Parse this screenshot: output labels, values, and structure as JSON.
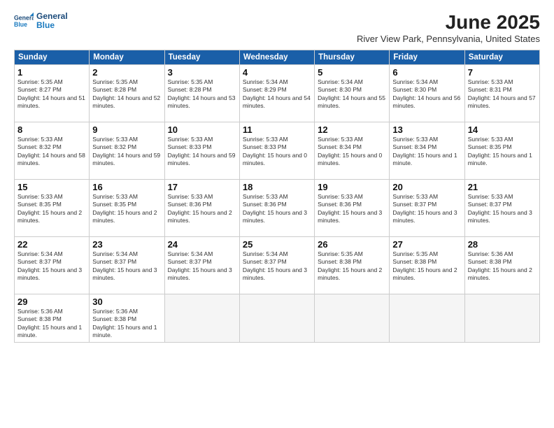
{
  "header": {
    "logo_line1": "General",
    "logo_line2": "Blue",
    "title": "June 2025",
    "location": "River View Park, Pennsylvania, United States"
  },
  "days_of_week": [
    "Sunday",
    "Monday",
    "Tuesday",
    "Wednesday",
    "Thursday",
    "Friday",
    "Saturday"
  ],
  "weeks": [
    [
      {
        "num": "1",
        "sunrise": "5:35 AM",
        "sunset": "8:27 PM",
        "daylight": "14 hours and 51 minutes."
      },
      {
        "num": "2",
        "sunrise": "5:35 AM",
        "sunset": "8:28 PM",
        "daylight": "14 hours and 52 minutes."
      },
      {
        "num": "3",
        "sunrise": "5:35 AM",
        "sunset": "8:28 PM",
        "daylight": "14 hours and 53 minutes."
      },
      {
        "num": "4",
        "sunrise": "5:34 AM",
        "sunset": "8:29 PM",
        "daylight": "14 hours and 54 minutes."
      },
      {
        "num": "5",
        "sunrise": "5:34 AM",
        "sunset": "8:30 PM",
        "daylight": "14 hours and 55 minutes."
      },
      {
        "num": "6",
        "sunrise": "5:34 AM",
        "sunset": "8:30 PM",
        "daylight": "14 hours and 56 minutes."
      },
      {
        "num": "7",
        "sunrise": "5:33 AM",
        "sunset": "8:31 PM",
        "daylight": "14 hours and 57 minutes."
      }
    ],
    [
      {
        "num": "8",
        "sunrise": "5:33 AM",
        "sunset": "8:32 PM",
        "daylight": "14 hours and 58 minutes."
      },
      {
        "num": "9",
        "sunrise": "5:33 AM",
        "sunset": "8:32 PM",
        "daylight": "14 hours and 59 minutes."
      },
      {
        "num": "10",
        "sunrise": "5:33 AM",
        "sunset": "8:33 PM",
        "daylight": "14 hours and 59 minutes."
      },
      {
        "num": "11",
        "sunrise": "5:33 AM",
        "sunset": "8:33 PM",
        "daylight": "15 hours and 0 minutes."
      },
      {
        "num": "12",
        "sunrise": "5:33 AM",
        "sunset": "8:34 PM",
        "daylight": "15 hours and 0 minutes."
      },
      {
        "num": "13",
        "sunrise": "5:33 AM",
        "sunset": "8:34 PM",
        "daylight": "15 hours and 1 minute."
      },
      {
        "num": "14",
        "sunrise": "5:33 AM",
        "sunset": "8:35 PM",
        "daylight": "15 hours and 1 minute."
      }
    ],
    [
      {
        "num": "15",
        "sunrise": "5:33 AM",
        "sunset": "8:35 PM",
        "daylight": "15 hours and 2 minutes."
      },
      {
        "num": "16",
        "sunrise": "5:33 AM",
        "sunset": "8:35 PM",
        "daylight": "15 hours and 2 minutes."
      },
      {
        "num": "17",
        "sunrise": "5:33 AM",
        "sunset": "8:36 PM",
        "daylight": "15 hours and 2 minutes."
      },
      {
        "num": "18",
        "sunrise": "5:33 AM",
        "sunset": "8:36 PM",
        "daylight": "15 hours and 3 minutes."
      },
      {
        "num": "19",
        "sunrise": "5:33 AM",
        "sunset": "8:36 PM",
        "daylight": "15 hours and 3 minutes."
      },
      {
        "num": "20",
        "sunrise": "5:33 AM",
        "sunset": "8:37 PM",
        "daylight": "15 hours and 3 minutes."
      },
      {
        "num": "21",
        "sunrise": "5:33 AM",
        "sunset": "8:37 PM",
        "daylight": "15 hours and 3 minutes."
      }
    ],
    [
      {
        "num": "22",
        "sunrise": "5:34 AM",
        "sunset": "8:37 PM",
        "daylight": "15 hours and 3 minutes."
      },
      {
        "num": "23",
        "sunrise": "5:34 AM",
        "sunset": "8:37 PM",
        "daylight": "15 hours and 3 minutes."
      },
      {
        "num": "24",
        "sunrise": "5:34 AM",
        "sunset": "8:37 PM",
        "daylight": "15 hours and 3 minutes."
      },
      {
        "num": "25",
        "sunrise": "5:34 AM",
        "sunset": "8:37 PM",
        "daylight": "15 hours and 3 minutes."
      },
      {
        "num": "26",
        "sunrise": "5:35 AM",
        "sunset": "8:38 PM",
        "daylight": "15 hours and 2 minutes."
      },
      {
        "num": "27",
        "sunrise": "5:35 AM",
        "sunset": "8:38 PM",
        "daylight": "15 hours and 2 minutes."
      },
      {
        "num": "28",
        "sunrise": "5:36 AM",
        "sunset": "8:38 PM",
        "daylight": "15 hours and 2 minutes."
      }
    ],
    [
      {
        "num": "29",
        "sunrise": "5:36 AM",
        "sunset": "8:38 PM",
        "daylight": "15 hours and 1 minute."
      },
      {
        "num": "30",
        "sunrise": "5:36 AM",
        "sunset": "8:38 PM",
        "daylight": "15 hours and 1 minute."
      },
      null,
      null,
      null,
      null,
      null
    ]
  ]
}
